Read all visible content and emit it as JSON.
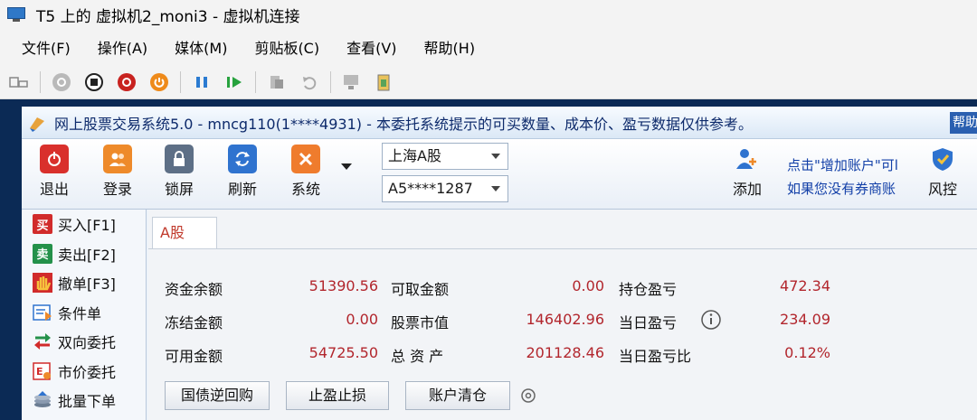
{
  "vm": {
    "title": "T5 上的 虚拟机2_moni3 - 虚拟机连接",
    "menu": [
      "文件(F)",
      "操作(A)",
      "媒体(M)",
      "剪贴板(C)",
      "查看(V)",
      "帮助(H)"
    ]
  },
  "app": {
    "title": "网上股票交易系统5.0 - mncg110(1****4931) - 本委托系统提示的可买数量、成本价、盈亏数据仅供参考。",
    "help_label": "帮助",
    "toolbar": {
      "exit": "退出",
      "login": "登录",
      "lock": "锁屏",
      "refresh": "刷新",
      "system": "系统",
      "add": "添加",
      "risk": "风控"
    },
    "market_select": "上海A股",
    "account_select": "A5****1287",
    "hint_line1": "点击\"增加账户\"可l",
    "hint_line2": "如果您没有券商账"
  },
  "sidebar": {
    "items": [
      {
        "icon_char": "买",
        "label": "买入[F1]"
      },
      {
        "icon_char": "卖",
        "label": "卖出[F2]"
      },
      {
        "icon_char": "",
        "label": "撤单[F3]"
      },
      {
        "icon_char": "",
        "label": "条件单"
      },
      {
        "icon_char": "",
        "label": "双向委托"
      },
      {
        "icon_char": "",
        "label": "市价委托"
      },
      {
        "icon_char": "",
        "label": "批量下单"
      }
    ]
  },
  "main": {
    "tab": "A股",
    "fields": {
      "fund_balance_label": "资金余额",
      "fund_balance": "51390.56",
      "frozen_label": "冻结金额",
      "frozen": "0.00",
      "available_label": "可用金额",
      "available": "54725.50",
      "withdrawable_label": "可取金额",
      "withdrawable": "0.00",
      "stock_value_label": "股票市值",
      "stock_value": "146402.96",
      "total_assets_label": "总 资 产",
      "total_assets": "201128.46",
      "position_pnl_label": "持仓盈亏",
      "position_pnl": "472.34",
      "daily_pnl_label": "当日盈亏",
      "daily_pnl": "234.09",
      "daily_pnl_ratio_label": "当日盈亏比",
      "daily_pnl_ratio": "0.12%"
    },
    "buttons": {
      "repo": "国债逆回购",
      "stop": "止盈止损",
      "clear": "账户清仓"
    }
  },
  "colors": {
    "value_red": "#b2262d",
    "hint_blue": "#1340a8",
    "exit_red": "#d9302c",
    "login_orange": "#ee8a2a"
  }
}
